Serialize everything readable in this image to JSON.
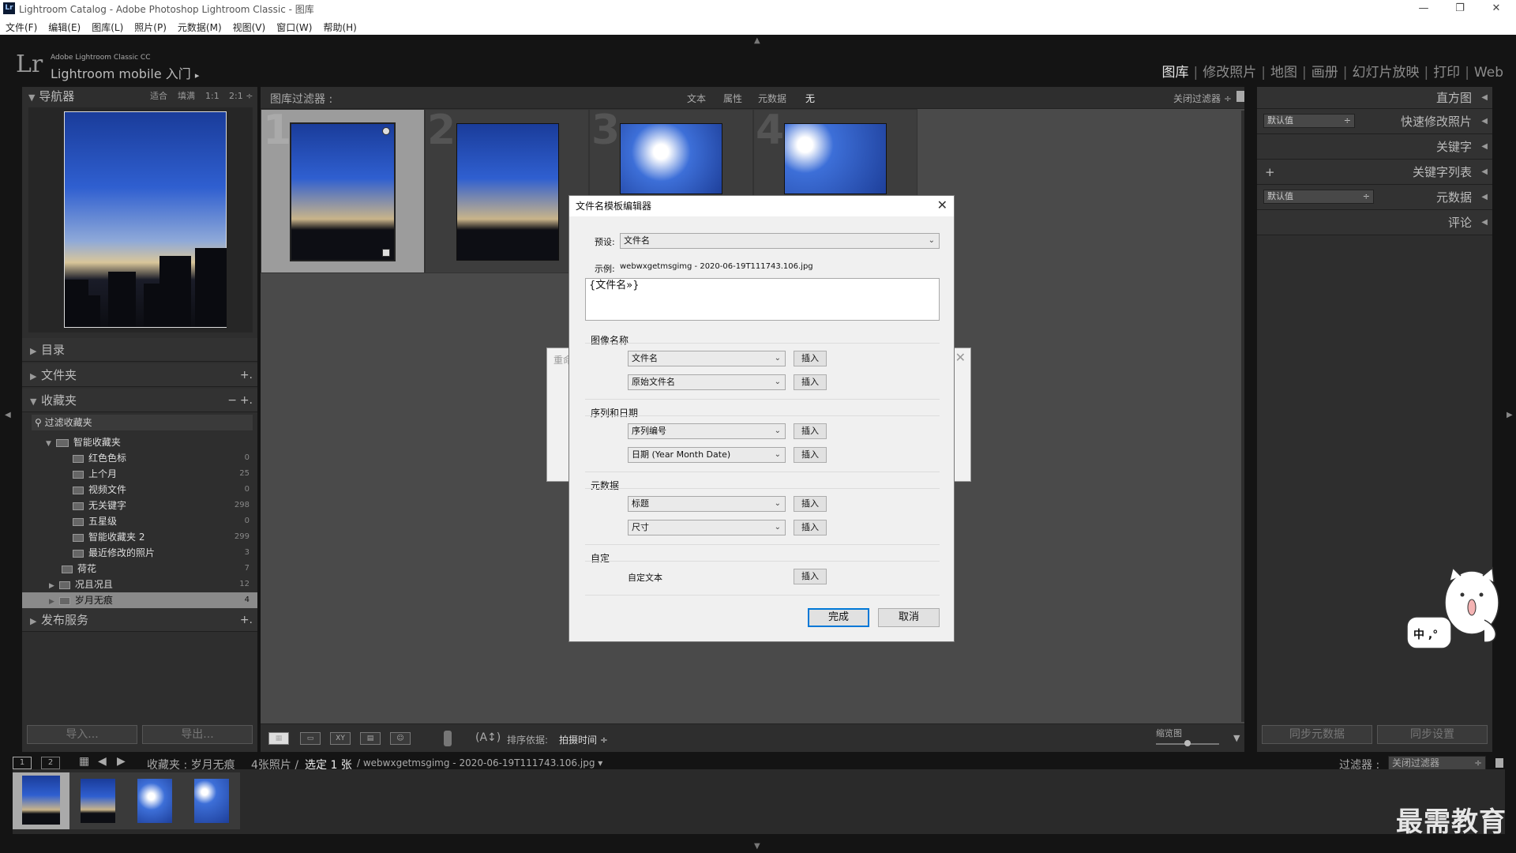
{
  "window": {
    "title": "Lightroom Catalog - Adobe Photoshop Lightroom Classic - 图库",
    "app_icon": "Lr"
  },
  "menu": [
    "文件(F)",
    "编辑(E)",
    "图库(L)",
    "照片(P)",
    "元数据(M)",
    "视图(V)",
    "窗口(W)",
    "帮助(H)"
  ],
  "identity": {
    "logo": "Lr",
    "product": "Adobe Lightroom Classic CC",
    "mobile": "Lightroom mobile 入门",
    "arrow": "▸"
  },
  "modules": [
    {
      "label": "图库",
      "active": true
    },
    {
      "label": "修改照片"
    },
    {
      "label": "地图"
    },
    {
      "label": "画册"
    },
    {
      "label": "幻灯片放映"
    },
    {
      "label": "打印"
    },
    {
      "label": "Web"
    }
  ],
  "navigator": {
    "title": "导航器",
    "zoom": [
      "适合",
      "填满",
      "1:1",
      "2:1 ÷"
    ]
  },
  "left_sections": {
    "catalog": "目录",
    "folders": "文件夹",
    "collections": "收藏夹",
    "publish": "发布服务"
  },
  "collections": {
    "filter": "过滤收藏夹",
    "smart_root": "智能收藏夹",
    "items": [
      {
        "label": "红色色标",
        "count": "0"
      },
      {
        "label": "上个月",
        "count": "25"
      },
      {
        "label": "视频文件",
        "count": "0"
      },
      {
        "label": "无关键字",
        "count": "298"
      },
      {
        "label": "五星级",
        "count": "0"
      },
      {
        "label": "智能收藏夹 2",
        "count": "299"
      },
      {
        "label": "最近修改的照片",
        "count": "3"
      }
    ],
    "others": [
      {
        "label": "荷花",
        "count": "7"
      },
      {
        "label": "况且况且",
        "count": "12"
      },
      {
        "label": "岁月无痕",
        "count": "4",
        "selected": true
      }
    ]
  },
  "left_buttons": {
    "import": "导入...",
    "export": "导出..."
  },
  "filterbar": {
    "label": "图库过滤器 :",
    "tabs": [
      "文本",
      "属性",
      "元数据",
      "无"
    ],
    "off": "关闭过滤器 ÷"
  },
  "grid": {
    "cells": [
      "1",
      "2",
      "3",
      "4"
    ]
  },
  "toolbar": {
    "sort_label": "排序依据:",
    "sort_value": "拍摄时间 ÷",
    "thumb_label": "缩览图"
  },
  "right_panel": {
    "histogram": "直方图",
    "quick_develop": "快速修改照片",
    "keywording": "关键字",
    "keyword_list": "关键字列表",
    "metadata": "元数据",
    "comments": "评论",
    "preset_default": "默认值",
    "sync_metadata": "同步元数据",
    "sync_settings": "同步设置"
  },
  "filmbar": {
    "pages": [
      "1",
      "2"
    ],
    "source": "收藏夹 : 岁月无痕",
    "count": "4张照片 /",
    "selected": "选定 1 张",
    "filename": "/ webwxgetmsgimg - 2020-06-19T111743.106.jpg ▾",
    "filter_label": "过滤器 :",
    "filter_value": "关闭过滤器"
  },
  "watermark": "最需教育",
  "bg_dialog": {
    "title_fragment": "重命"
  },
  "dialog": {
    "title": "文件名模板编辑器",
    "preset_label": "预设:",
    "preset_value": "文件名",
    "example_label": "示例:",
    "example_value": "webwxgetmsgimg - 2020-06-19T111743.106.jpg",
    "template": "{文件名»}",
    "insert": "插入",
    "groups": {
      "image_name": {
        "label": "图像名称",
        "opts": [
          "文件名",
          "原始文件名"
        ]
      },
      "sequence": {
        "label": "序列和日期",
        "opts": [
          "序列编号",
          "日期 (Year Month Date)"
        ]
      },
      "metadata": {
        "label": "元数据",
        "opts": [
          "标题",
          "尺寸"
        ]
      },
      "custom": {
        "label": "自定",
        "text": "自定文本"
      }
    },
    "done": "完成",
    "cancel": "取消"
  },
  "mascot": {
    "text": "中 ,°"
  }
}
